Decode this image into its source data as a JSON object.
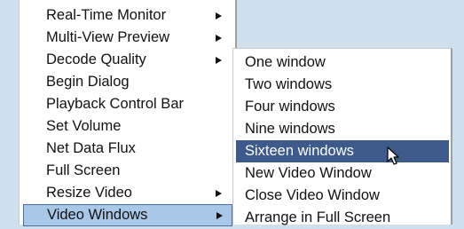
{
  "main_menu": {
    "items": [
      {
        "label": "Real-Time Monitor",
        "has_submenu": true
      },
      {
        "label": "Multi-View Preview",
        "has_submenu": true
      },
      {
        "label": "Decode Quality",
        "has_submenu": true
      },
      {
        "label": "Begin Dialog",
        "has_submenu": false
      },
      {
        "label": "Playback Control Bar",
        "has_submenu": false
      },
      {
        "label": "Set Volume",
        "has_submenu": false
      },
      {
        "label": "Net Data Flux",
        "has_submenu": false
      },
      {
        "label": "Full Screen",
        "has_submenu": false
      },
      {
        "label": "Resize Video",
        "has_submenu": true
      },
      {
        "label": "Video Windows",
        "has_submenu": true,
        "active": true
      }
    ]
  },
  "sub_menu": {
    "items": [
      {
        "label": "One window"
      },
      {
        "label": "Two windows"
      },
      {
        "label": "Four windows"
      },
      {
        "label": "Nine windows"
      },
      {
        "label": "Sixteen windows",
        "highlighted": true
      },
      {
        "label": "New Video Window"
      },
      {
        "label": "Close Video Window"
      },
      {
        "label": "Arrange in Full Screen"
      }
    ]
  },
  "colors": {
    "background": "#cfdfeb",
    "highlight": "#3d5a8a",
    "active_parent": "#a9c7e6"
  },
  "icons": {
    "submenu_arrow": "triangle-right-icon",
    "cursor": "mouse-pointer-icon"
  }
}
